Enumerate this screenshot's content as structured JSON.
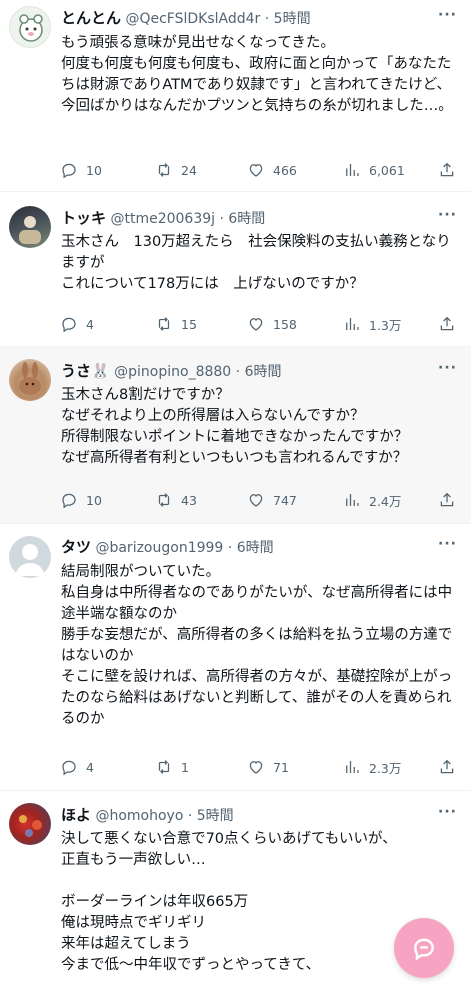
{
  "posts": [
    {
      "name": "とんとん",
      "handle": "@QecFSlDKslAdd4r",
      "time": "5時間",
      "text": "もう頑張る意味が見出せなくなってきた。\n何度も何度も何度も何度も、政府に面と向かって「あなたたちは財源でありATMであり奴隷です」と言われてきたけど、今回ばかりはなんだかプツンと気持ちの糸が切れました…。",
      "replies": "10",
      "reposts": "24",
      "likes": "466",
      "views": "6,061",
      "highlighted": false
    },
    {
      "name": "トッキ",
      "handle": "@ttme200639j",
      "time": "6時間",
      "text": "玉木さん　130万超えたら　社会保険料の支払い義務となりますが\nこれについて178万には　上げないのですか？",
      "replies": "4",
      "reposts": "15",
      "likes": "158",
      "views": "1.3万",
      "highlighted": false
    },
    {
      "name": "うさ🐰",
      "handle": "@pinopino_8880",
      "time": "6時間",
      "text": "玉木さん8割だけですか？\nなぜそれより上の所得層は入らないんですか？\n所得制限ないポイントに着地できなかったんですか？\nなぜ高所得者有利といつもいつも言われるんですか？",
      "replies": "10",
      "reposts": "43",
      "likes": "747",
      "views": "2.4万",
      "highlighted": true
    },
    {
      "name": "タツ",
      "handle": "@barizougon1999",
      "time": "6時間",
      "text": "結局制限がついていた。\n私自身は中所得者なのでありがたいが、なぜ高所得者には中途半端な額なのか\n勝手な妄想だが、高所得者の多くは給料を払う立場の方達ではないのか\nそこに壁を設ければ、高所得者の方々が、基礎控除が上がったのなら給料はあげないと判断して、誰がその人を責められるのか",
      "replies": "4",
      "reposts": "1",
      "likes": "71",
      "views": "2.3万",
      "highlighted": false
    },
    {
      "name": "ほよ",
      "handle": "@homohoyo",
      "time": "5時間",
      "text": "決して悪くない合意で70点くらいあげてもいいが、\n正直もう一声欲しい…\n\nボーダーラインは年収665万\n俺は現時点でギリギリ\n来年は超えてしまう\n今まで低〜中年収でずっとやってきて、",
      "highlighted": false
    }
  ],
  "separator": " · ",
  "more_glyph": "···",
  "icons": {
    "reply": "reply-icon",
    "repost": "repost-icon",
    "like": "heart-icon",
    "views": "views-icon",
    "share": "share-icon",
    "compose": "compose-icon"
  },
  "colors": {
    "text": "#0f1419",
    "muted": "#536471",
    "highlight_bg": "#f7f7f7",
    "fab": "#f6a4c2"
  }
}
